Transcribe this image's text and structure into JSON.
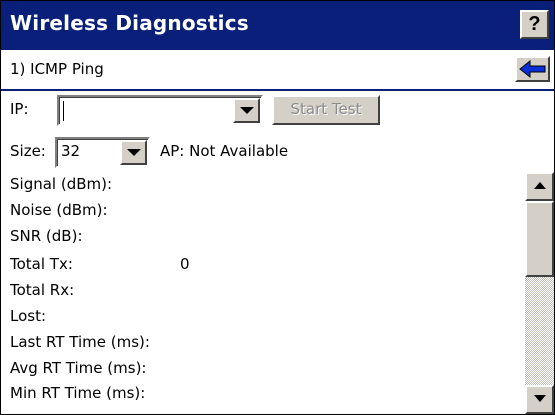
{
  "window": {
    "title": "Wireless Diagnostics",
    "help_label": "?"
  },
  "subheader": {
    "section": "1) ICMP Ping"
  },
  "ip": {
    "label": "IP:",
    "value": ""
  },
  "start_button": "Start Test",
  "size": {
    "label": "Size:",
    "value": "32"
  },
  "ap_status": "AP: Not Available",
  "stats": [
    {
      "label": "Signal (dBm):",
      "value": ""
    },
    {
      "label": "Noise (dBm):",
      "value": ""
    },
    {
      "label": "SNR (dB):",
      "value": ""
    },
    {
      "label": "Total Tx:",
      "value": "0"
    },
    {
      "label": "Total Rx:",
      "value": ""
    },
    {
      "label": "Lost:",
      "value": ""
    },
    {
      "label": "Last RT Time (ms):",
      "value": ""
    },
    {
      "label": "Avg RT Time (ms):",
      "value": ""
    },
    {
      "label": "Min RT Time (ms):",
      "value": ""
    }
  ],
  "colors": {
    "titlebar": "#0a1f7a",
    "face": "#d4d0c8",
    "disabled_text": "#8a8a8a",
    "back_arrow": "#0a2fd6"
  },
  "icons": {
    "help": "question-icon",
    "back": "left-arrow-icon",
    "dropdown": "triangle-down-icon",
    "scroll_up": "triangle-up-icon",
    "scroll_down": "triangle-down-icon"
  }
}
